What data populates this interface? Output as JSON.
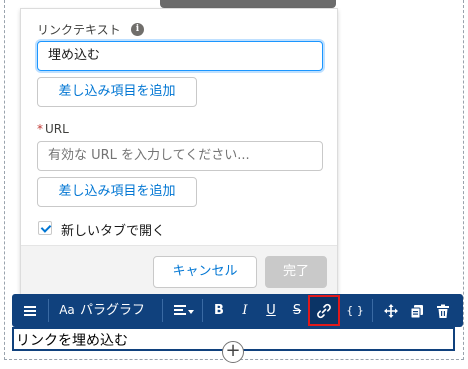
{
  "popover": {
    "link_text_label": "リンクテキスト",
    "link_text_value": "埋め込む",
    "add_merge_field_1": "差し込み項目を追加",
    "url_required_mark": "*",
    "url_label": "URL",
    "url_placeholder": "有効な URL を入力してください...",
    "add_merge_field_2": "差し込み項目を追加",
    "open_new_tab_label": "新しいタブで開く",
    "open_new_tab_checked": true,
    "cancel_label": "キャンセル",
    "done_label": "完了"
  },
  "toolbar": {
    "text_style_icon_label": "Aa",
    "paragraph_label": "パラグラフ",
    "bold": "B",
    "italic": "I",
    "underline": "U",
    "strike": "S",
    "code": "{ }",
    "link_active": true
  },
  "editor": {
    "block_text": "リンクを埋め込む",
    "add_symbol": "+"
  },
  "colors": {
    "toolbar_bg": "#10417d",
    "link_highlight": "#e0191b",
    "brand_blue": "#0176d3"
  },
  "icons": [
    "menu-icon",
    "text-style-icon",
    "align-icon",
    "link-icon",
    "move-icon",
    "copy-icon",
    "trash-icon",
    "info-icon",
    "plus-icon"
  ]
}
